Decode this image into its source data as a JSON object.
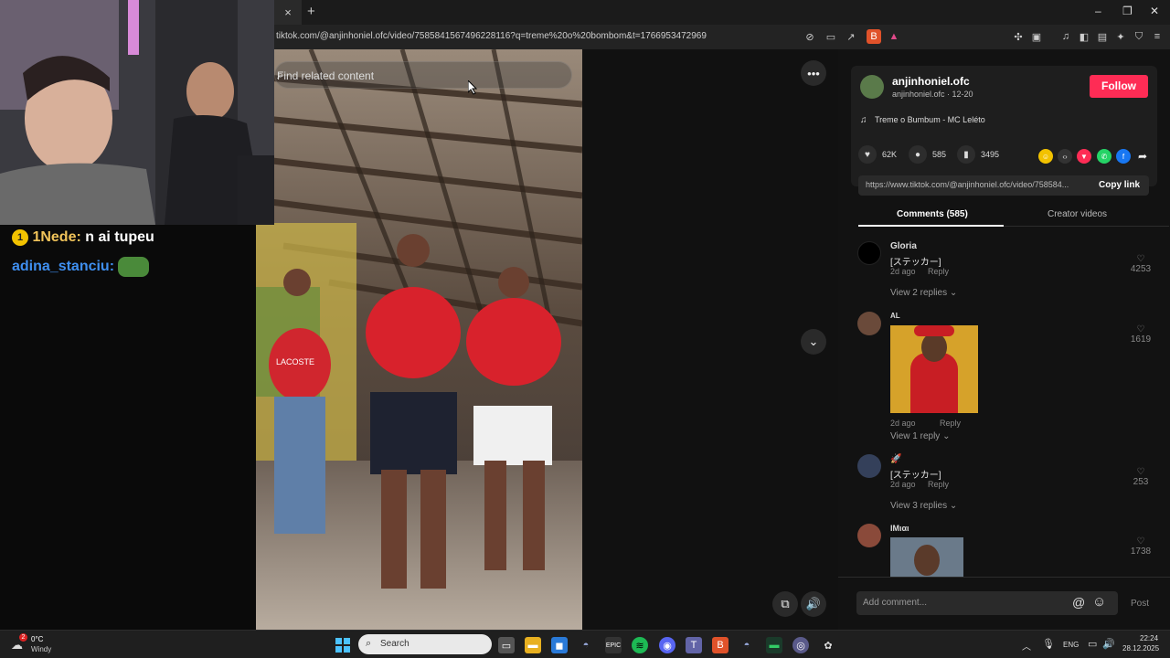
{
  "browser": {
    "tab_close": "×",
    "new_tab": "+",
    "url": "tiktok.com/@anjinhoniel.ofc/video/7585841567496228116?q=treme%20o%20bombom&t=1766953472969",
    "window_controls": [
      "–",
      "❐",
      "✕"
    ]
  },
  "video": {
    "search_placeholder": "Find related content",
    "more_icon": "•••",
    "next_icon": "⌄",
    "volume_icon": "🔊",
    "pip_icon": "⧉",
    "shirt_text": "LACOSTE"
  },
  "creator": {
    "username": "anjinhoniel.ofc",
    "subline": "anjinhoniel.ofc · 12-20",
    "follow_label": "Follow",
    "music": "Treme o Bumbum - MC Leléto"
  },
  "stats": {
    "likes": "62K",
    "comments": "585",
    "saves": "3495"
  },
  "link": {
    "url": "https://www.tiktok.com/@anjinhoniel.ofc/video/758584...",
    "copy_label": "Copy link"
  },
  "panel_tabs": {
    "comments": "Comments (585)",
    "creator_videos": "Creator videos"
  },
  "comments": [
    {
      "name": "Gloria",
      "text": "[ステッカー]",
      "date": "2d ago",
      "reply": "Reply",
      "likes": "4253",
      "view_replies": "View 2 replies"
    },
    {
      "name": "AL",
      "text": "",
      "date": "2d ago",
      "reply": "Reply",
      "likes": "1619",
      "view_replies": "View 1 reply"
    },
    {
      "name": "🚀",
      "text": "[ステッカー]",
      "date": "2d ago",
      "reply": "Reply",
      "likes": "253",
      "view_replies": "View 3 replies"
    },
    {
      "name": "ΙΜιαι",
      "text": "",
      "date": "",
      "reply": "",
      "likes": "1738",
      "view_replies": ""
    }
  ],
  "add_comment": {
    "placeholder": "Add comment...",
    "at_icon": "@",
    "emoji_icon": "☺",
    "post_label": "Post"
  },
  "chat": [
    {
      "badge": "1",
      "user": "1Nede:",
      "message": "n ai tupeu",
      "user_color": "#f0c35a"
    },
    {
      "user": "adina_stanciu:",
      "message": "",
      "user_color": "#3f8ff0"
    }
  ],
  "taskbar": {
    "weather_temp": "0°C",
    "weather_desc": "Windy",
    "weather_badge": "2",
    "search_placeholder": "Search",
    "lang": "ENG",
    "time": "22:24",
    "date": "28.12.2025"
  },
  "colors": {
    "follow": "#fe2c55",
    "panel_bg": "#121212",
    "accent_blue": "#3f8ff0"
  }
}
